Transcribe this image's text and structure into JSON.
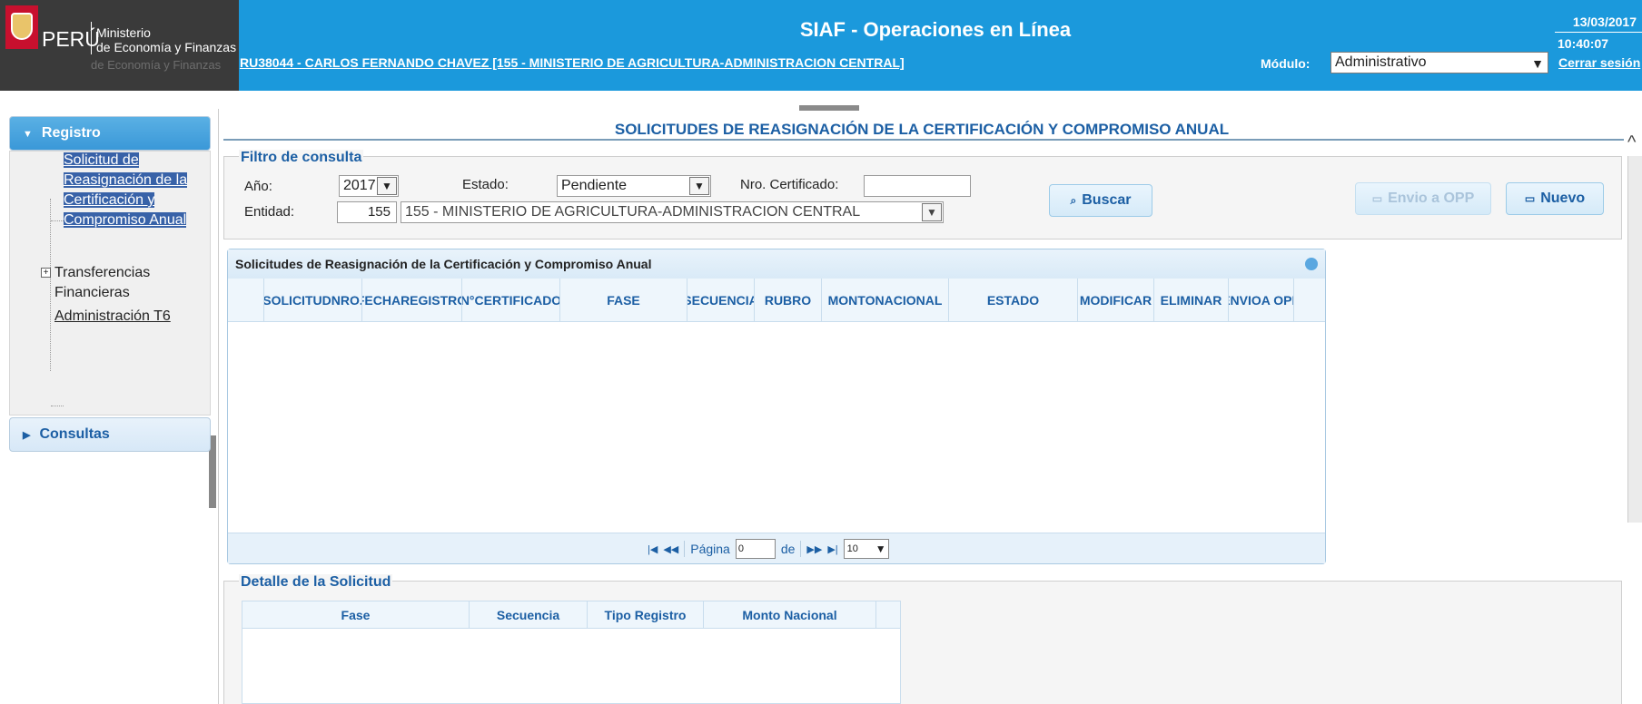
{
  "header": {
    "logo_country": "PERÚ",
    "logo_ministry_line1": "Ministerio",
    "logo_ministry_line2": "de Economía y Finanzas",
    "logo_ghost_text": "de Economía y Finanzas",
    "app_title": "SIAF - Operaciones en Línea",
    "user_link": "RU38044 - CARLOS FERNANDO CHAVEZ [155 - MINISTERIO DE AGRICULTURA-ADMINISTRACION CENTRAL]",
    "date": "13/03/2017",
    "time": "10:40:07",
    "modulo_label": "Módulo:",
    "modulo_value": "Administrativo",
    "logout_label": "Cerrar sesión",
    "colors": {
      "bar": "#1b99dc",
      "text": "#ffffff"
    }
  },
  "sidebar": {
    "registro_label": "Registro",
    "consultas_label": "Consultas",
    "items": [
      {
        "label": "Solicitud de Reasignación de la Certificación y Compromiso Anual",
        "selected": true
      },
      {
        "label": "Transferencias Financieras",
        "expandable": true
      },
      {
        "label": "Administración T6"
      }
    ]
  },
  "main": {
    "page_title": "SOLICITUDES DE REASIGNACIÓN DE LA CERTIFICACIÓN Y COMPROMISO ANUAL",
    "filter": {
      "legend": "Filtro de consulta",
      "anio_label": "Año:",
      "anio_value": "2017",
      "estado_label": "Estado:",
      "estado_value": "Pendiente",
      "nro_cert_label": "Nro. Certificado:",
      "nro_cert_value": "",
      "entidad_label": "Entidad:",
      "entidad_code": "155",
      "entidad_value": "155 - MINISTERIO DE AGRICULTURA-ADMINISTRACION CENTRAL",
      "buscar_label": "Buscar",
      "envio_opp_label": "Envio a OPP",
      "nuevo_label": "Nuevo"
    },
    "grid": {
      "caption": "Solicitudes de Reasignación de la Certificación y Compromiso Anual",
      "columns": [
        [
          "SOLICITUD",
          "NRO."
        ],
        [
          "FECHA",
          "REGISTRO"
        ],
        [
          "N°",
          "CERTIFICADO"
        ],
        [
          "FASE"
        ],
        [
          "SECUENCIA"
        ],
        [
          "RUBRO"
        ],
        [
          "MONTO",
          "NACIONAL"
        ],
        [
          "ESTADO"
        ],
        [
          "MODIFICAR"
        ],
        [
          "ELIMINAR"
        ],
        [
          "ENVIO",
          "A OPP"
        ]
      ],
      "rows": [],
      "pager": {
        "page_label": "Página",
        "page_value": "0",
        "of_label": "de",
        "page_size": "10"
      }
    },
    "detail": {
      "legend": "Detalle de la Solicitud",
      "columns": [
        "Fase",
        "Secuencia",
        "Tipo Registro",
        "Monto Nacional"
      ],
      "rows": []
    }
  }
}
